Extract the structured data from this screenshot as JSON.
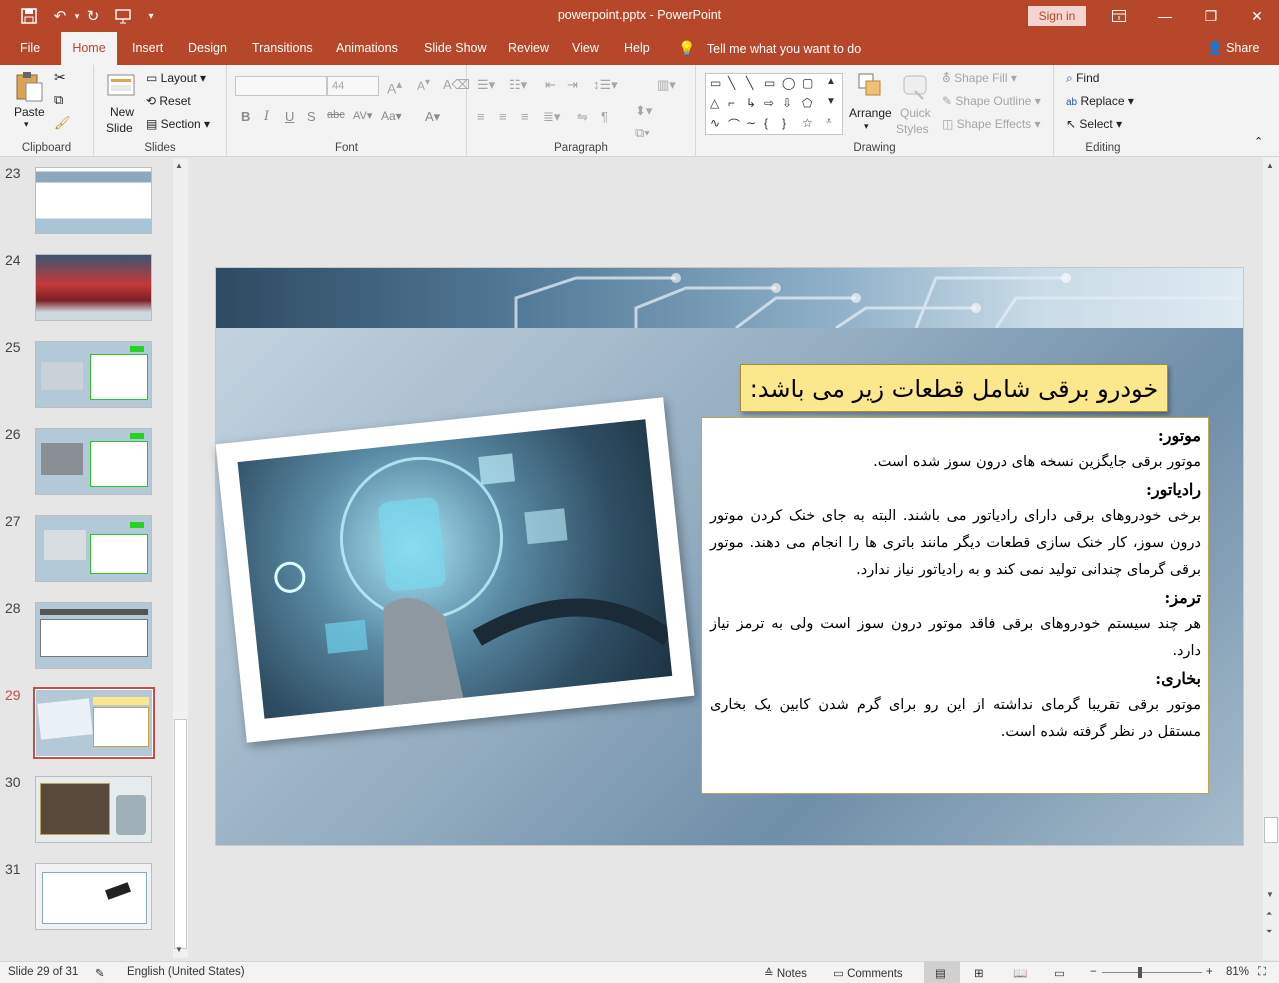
{
  "titlebar": {
    "title": "powerpoint.pptx - PowerPoint",
    "signin": "Sign in",
    "accent": "#b7472a"
  },
  "tabs": [
    "File",
    "Home",
    "Insert",
    "Design",
    "Transitions",
    "Animations",
    "Slide Show",
    "Review",
    "View",
    "Help"
  ],
  "tell_me": "Tell me what you want to do",
  "share": "Share",
  "ribbon": {
    "clipboard": {
      "paste": "Paste",
      "label": "Clipboard"
    },
    "slides": {
      "new_slide_1": "New",
      "new_slide_2": "Slide",
      "layout": "Layout",
      "reset": "Reset",
      "section": "Section",
      "label": "Slides"
    },
    "font": {
      "font_name": "",
      "font_size": "44",
      "label": "Font"
    },
    "paragraph": {
      "label": "Paragraph"
    },
    "drawing": {
      "arrange": "Arrange",
      "quick_styles_1": "Quick",
      "quick_styles_2": "Styles",
      "shape_fill": "Shape Fill",
      "shape_outline": "Shape Outline",
      "shape_effects": "Shape Effects",
      "label": "Drawing"
    },
    "editing": {
      "find": "Find",
      "replace": "Replace",
      "select": "Select",
      "label": "Editing"
    }
  },
  "thumbnails": [
    {
      "num": "23"
    },
    {
      "num": "24"
    },
    {
      "num": "25"
    },
    {
      "num": "26"
    },
    {
      "num": "27"
    },
    {
      "num": "28"
    },
    {
      "num": "29"
    },
    {
      "num": "30"
    },
    {
      "num": "31"
    }
  ],
  "slide": {
    "heading": "خودرو برقی شامل قطعات زیر می باشد:",
    "h1": "موتور:",
    "p1": "موتور برقی جایگزین نسخه های درون سوز شده است.",
    "h2": "رادیاتور:",
    "p2": "برخی خودروهای برقی دارای رادیاتور می باشند. البته به جای خنک کردن موتور درون سوز، کار خنک سازی قطعات دیگر مانند باتری ها را انجام می دهند. موتور برقی گرمای چندانی تولید نمی کند و به رادیاتور نیاز ندارد.",
    "h3": "ترمز:",
    "p3": "هر چند سیستم خودروهای برقی فاقد موتور درون سوز است ولی به ترمز نیاز دارد.",
    "h4": "بخاری:",
    "p4": "موتور برقی تقریبا گرمای نداشته از این رو برای گرم شدن کابین یک بخاری مستقل در نظر گرفته شده است."
  },
  "status": {
    "slide_info": "Slide 29 of 31",
    "language": "English (United States)",
    "notes": "Notes",
    "comments": "Comments",
    "zoom": "81%"
  }
}
